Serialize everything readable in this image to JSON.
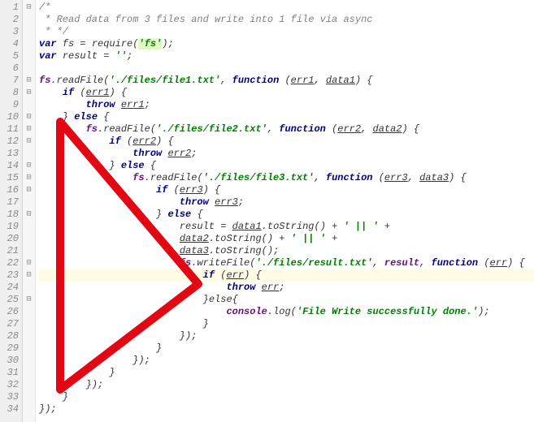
{
  "lines": {
    "n1": "1",
    "n2": "2",
    "n3": "3",
    "n4": "4",
    "n5": "5",
    "n6": "6",
    "n7": "7",
    "n8": "8",
    "n9": "9",
    "n10": "10",
    "n11": "11",
    "n12": "12",
    "n13": "13",
    "n14": "14",
    "n15": "15",
    "n16": "16",
    "n17": "17",
    "n18": "18",
    "n19": "19",
    "n20": "20",
    "n21": "21",
    "n22": "22",
    "n23": "23",
    "n24": "24",
    "n25": "25",
    "n26": "26",
    "n27": "27",
    "n28": "28",
    "n29": "29",
    "n30": "30",
    "n31": "31",
    "n32": "32",
    "n33": "33",
    "n34": "34"
  },
  "fold": {
    "f1": "⊟",
    "f7": "⊟",
    "f8": "⊟",
    "f10": "⊟",
    "f11": "⊟",
    "f12": "⊟",
    "f14": "⊟",
    "f15": "⊟",
    "f16": "⊟",
    "f18": "⊟",
    "f22": "⊟",
    "f23": "⊟",
    "f25": "⊟"
  },
  "t": {
    "comment_open": "/*",
    "comment_line": " * Read data from 3 files and write into 1 file via async",
    "comment_close": " * */",
    "var": "var",
    "fs": "fs",
    "eq": " = ",
    "require": "require",
    "lpar": "(",
    "rpar": ")",
    "semi": ";",
    "fs_mod": "'fs'",
    "result": "result",
    "empty_str": "''",
    "dot": ".",
    "readFile": "readFile",
    "writeFile": "writeFile",
    "file1": "'./files/file1.txt'",
    "file2": "'./files/file2.txt'",
    "file3": "'./files/file3.txt'",
    "file_result": "'./files/result.txt'",
    "comma_sp": ", ",
    "function": "function",
    "space": " ",
    "err1": "err1",
    "err2": "err2",
    "err3": "err3",
    "err": "err",
    "data1": "data1",
    "data2": "data2",
    "data3": "data3",
    "lbrace_sp": " {",
    "rbrace": "}",
    "if": "if",
    "else": "else",
    "throw": "throw",
    "toString": "toString",
    "plus_pipe": " + ",
    "pipe_str": "' || '",
    "plus": " +",
    "console": "console",
    "log": "log",
    "msg": "'File Write successfully done.'",
    "close_fn": "});",
    "elsebrace": "}else{"
  },
  "annotation_shape": "red-triangle"
}
